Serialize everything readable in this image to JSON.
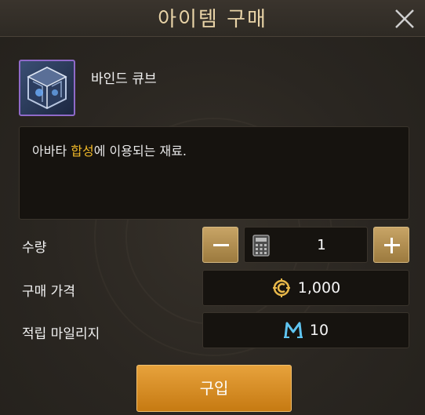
{
  "dialog": {
    "title": "아이템 구매",
    "close_icon": "close-icon"
  },
  "item": {
    "name": "바인드 큐브",
    "icon": "bind-cube-icon",
    "border_color": "#8f6ac9"
  },
  "description": {
    "before": "아바타 ",
    "highlight": "합성",
    "after": "에 이용되는 재료.",
    "highlight_color": "#f1b928"
  },
  "quantity": {
    "label": "수량",
    "value": "1",
    "decrease_icon": "minus-icon",
    "increase_icon": "plus-icon",
    "calculator_icon": "calculator-icon"
  },
  "price": {
    "label": "구매 가격",
    "value": "1,000",
    "currency_icon": "gold-coin-icon"
  },
  "mileage": {
    "label": "적립 마일리지",
    "value": "10",
    "currency_icon": "mileage-m-icon"
  },
  "buy_button": {
    "label": "구입",
    "color": "#d68a1f"
  }
}
